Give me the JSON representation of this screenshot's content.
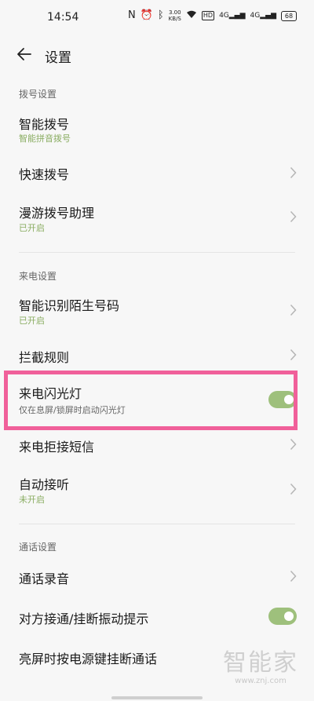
{
  "status_bar": {
    "time": "14:54",
    "network_speed_value": "3.00",
    "network_speed_unit": "KB/S",
    "hd_label": "HD",
    "signal1_label": "4G",
    "signal2_label": "4G",
    "battery": "68",
    "icons": [
      "nfc-icon",
      "alarm-icon",
      "bluetooth-icon",
      "wifi-icon"
    ]
  },
  "header": {
    "title": "设置"
  },
  "sections": {
    "dial": {
      "header": "拨号设置",
      "smart_dial": {
        "title": "智能拨号",
        "subtitle": "智能拼音拨号"
      },
      "speed_dial": {
        "title": "快速拨号"
      },
      "roaming": {
        "title": "漫游拨号助理",
        "subtitle": "已开启"
      }
    },
    "incoming": {
      "header": "来电设置",
      "identify": {
        "title": "智能识别陌生号码",
        "subtitle": "已开启"
      },
      "block": {
        "title": "拦截规则"
      },
      "flash": {
        "title": "来电闪光灯",
        "subtitle": "仅在息屏/锁屏时启动闪光灯",
        "enabled": true
      },
      "reject_sms": {
        "title": "来电拒接短信"
      },
      "auto_answer": {
        "title": "自动接听",
        "subtitle": "未开启"
      }
    },
    "call": {
      "header": "通话设置",
      "recording": {
        "title": "通话录音"
      },
      "vibration": {
        "title": "对方接通/挂断振动提示",
        "enabled": true
      },
      "power_hangup": {
        "title": "亮屏时按电源键挂断通话"
      }
    }
  },
  "watermark": {
    "text": "智能家",
    "url": "www.znj.com"
  },
  "colors": {
    "accent": "#9ec07c",
    "subtitle_green": "#8aad62",
    "highlight": "#f0609a",
    "background": "#f7f7f7"
  }
}
